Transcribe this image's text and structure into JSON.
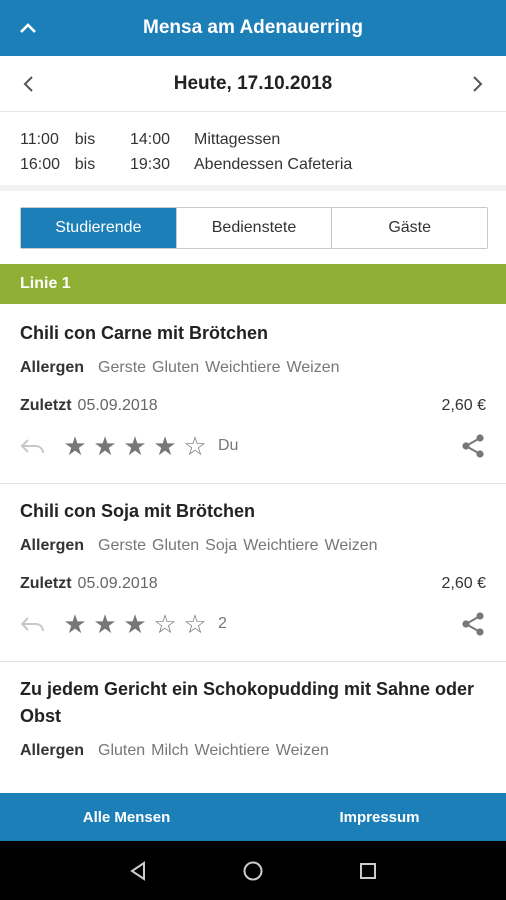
{
  "header": {
    "title": "Mensa am Adenauerring",
    "up_icon": "chevron-up-icon"
  },
  "datebar": {
    "date": "Heute, 17.10.2018",
    "prev_icon": "chevron-left-icon",
    "next_icon": "chevron-right-icon"
  },
  "hours": [
    {
      "from": "11:00",
      "sep": "bis",
      "to": "14:00",
      "label": "Mittagessen"
    },
    {
      "from": "16:00",
      "sep": "bis",
      "to": "19:30",
      "label": "Abendessen Cafeteria"
    }
  ],
  "tabs": [
    {
      "label": "Studierende",
      "active": true
    },
    {
      "label": "Bedienstete",
      "active": false
    },
    {
      "label": "Gäste",
      "active": false
    }
  ],
  "line_header": "Linie 1",
  "labels": {
    "allergen": "Allergen",
    "last": "Zuletzt"
  },
  "meals": [
    {
      "name": "Chili con Carne mit Brötchen",
      "allergens": [
        "Gerste",
        "Gluten",
        "Weichtiere",
        "Weizen"
      ],
      "last": "05.09.2018",
      "price": "2,60 €",
      "rating": 4,
      "rating_count": "Du"
    },
    {
      "name": "Chili con Soja mit Brötchen",
      "allergens": [
        "Gerste",
        "Gluten",
        "Soja",
        "Weichtiere",
        "Weizen"
      ],
      "last": "05.09.2018",
      "price": "2,60 €",
      "rating": 3,
      "rating_count": "2"
    },
    {
      "name": "Zu jedem Gericht ein Schokopudding mit Sahne oder Obst",
      "allergens": [
        "Gluten",
        "Milch",
        "Weichtiere",
        "Weizen"
      ]
    }
  ],
  "bottombar": {
    "left": "Alle Mensen",
    "right": "Impressum"
  },
  "colors": {
    "primary": "#1d7fb8",
    "line_header": "#8faf35"
  }
}
